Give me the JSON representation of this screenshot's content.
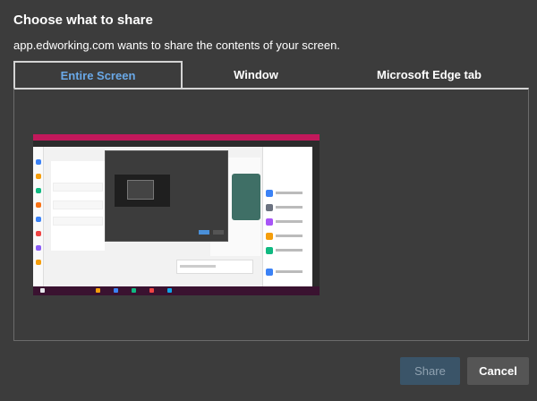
{
  "dialog": {
    "title": "Choose what to share",
    "subtitle": "app.edworking.com wants to share the contents of your screen."
  },
  "tabs": [
    {
      "label": "Entire Screen",
      "selected": true
    },
    {
      "label": "Window",
      "selected": false
    },
    {
      "label": "Microsoft Edge tab",
      "selected": false
    }
  ],
  "buttons": {
    "share_label": "Share",
    "cancel_label": "Cancel"
  },
  "colors": {
    "dialog_bg": "#3c3c3c",
    "selected_tab_text": "#6aa9e8",
    "share_bg": "#3a5468",
    "cancel_bg": "#555555",
    "browser_tabbar": "#c2185b"
  }
}
